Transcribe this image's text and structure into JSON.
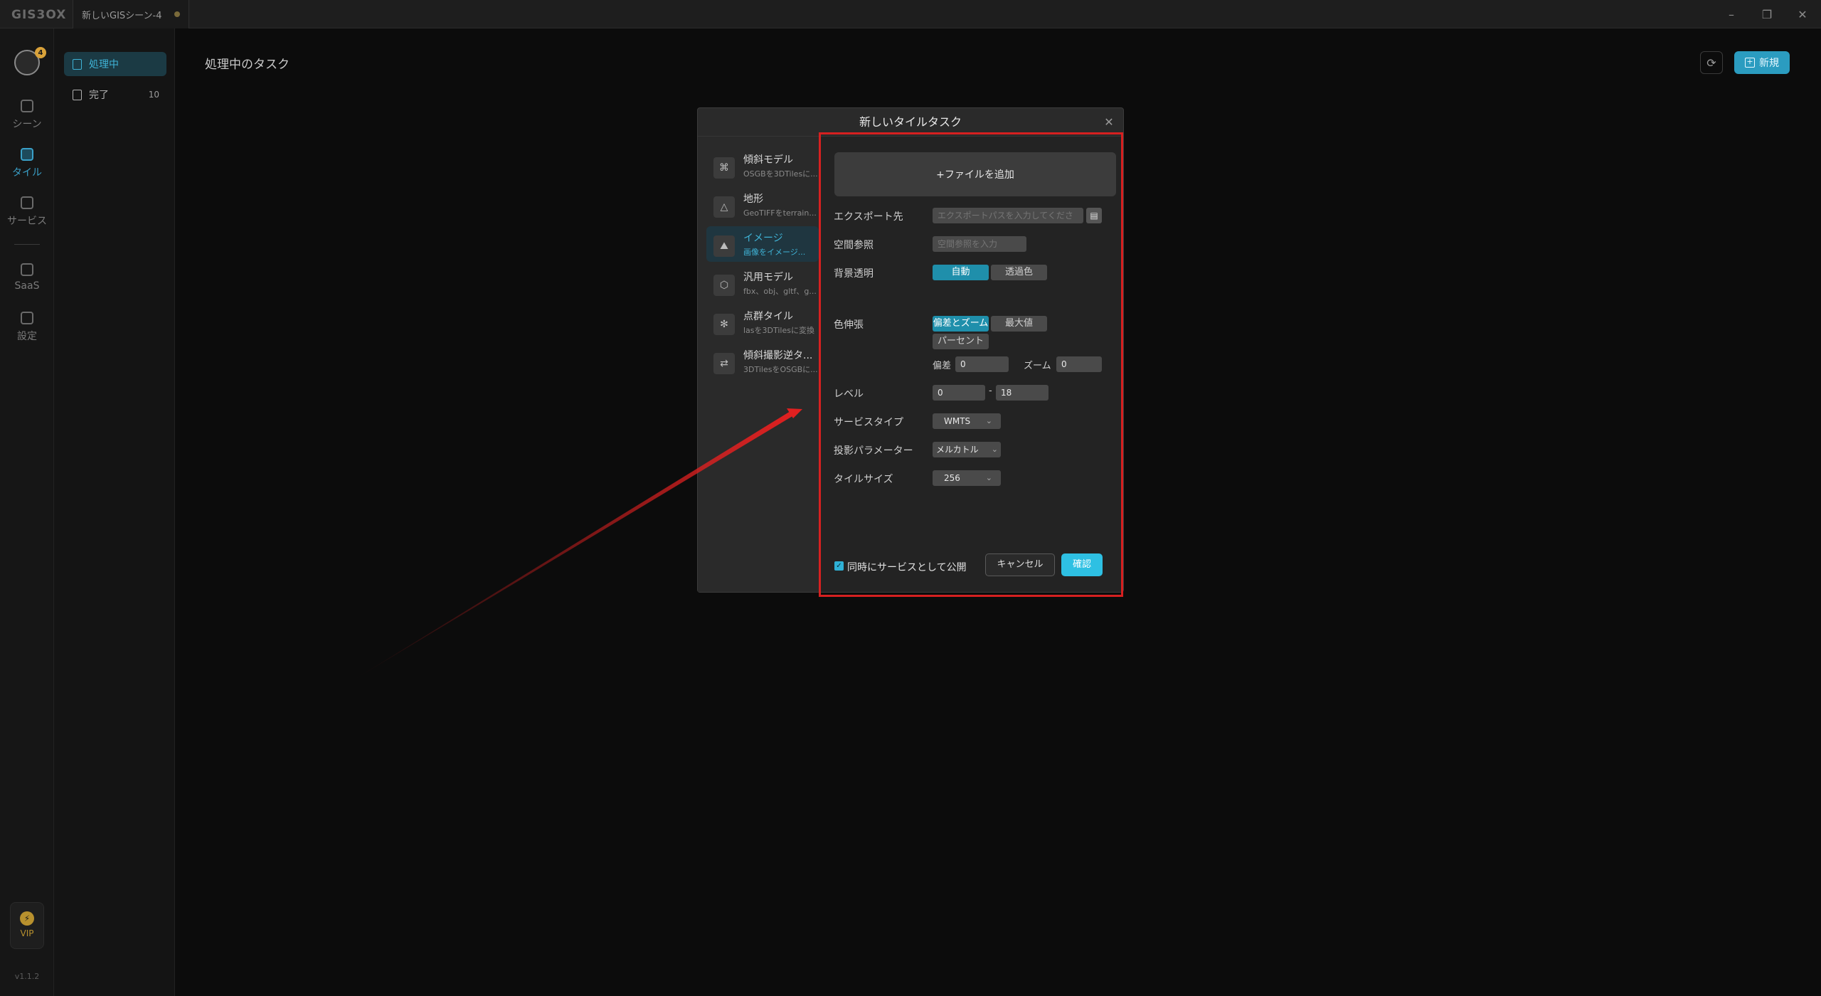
{
  "app": {
    "logo": "GIS3OX",
    "doc_tab": "新しいGISシーン-4"
  },
  "rail": {
    "avatar_badge": "4",
    "items": [
      {
        "label": "シーン",
        "icon": "scene-icon"
      },
      {
        "label": "タイル",
        "icon": "tile-icon"
      },
      {
        "label": "サービス",
        "icon": "service-icon"
      },
      {
        "label": "SaaS",
        "icon": "saas-icon"
      },
      {
        "label": "設定",
        "icon": "settings-icon"
      }
    ],
    "vip": "VIP",
    "version": "v1.1.2"
  },
  "sidenav": {
    "items": [
      {
        "label": "処理中",
        "count": ""
      },
      {
        "label": "完了",
        "count": "10"
      }
    ]
  },
  "main": {
    "title": "処理中のタスク",
    "new_label": "新規"
  },
  "dialog": {
    "title": "新しいタイルタスク",
    "types": [
      {
        "name": "傾斜モデル",
        "desc": "OSGBを3DTilesに..."
      },
      {
        "name": "地形",
        "desc": "GeoTIFFをterrain..."
      },
      {
        "name": "イメージ",
        "desc": "画像をイメージ..."
      },
      {
        "name": "汎用モデル",
        "desc": "fbx、obj、gltf、g..."
      },
      {
        "name": "点群タイル",
        "desc": "lasを3DTilesに変換"
      },
      {
        "name": "傾斜撮影逆タ...",
        "desc": "3DTilesをOSGBに..."
      }
    ],
    "add_file": "+ファイルを追加",
    "export": {
      "label": "エクスポート先",
      "placeholder": "エクスポートパスを入力してくださ"
    },
    "crs": {
      "label": "空間参照",
      "placeholder": "空間参照を入力"
    },
    "bg": {
      "label": "背景透明",
      "auto": "自動",
      "color": "透過色"
    },
    "stretch": {
      "label": "色伸張",
      "opt1": "偏差とズーム",
      "opt2": "最大値",
      "opt3": "パーセント",
      "offset_label": "偏差",
      "offset_value": "0",
      "zoom_label": "ズーム",
      "zoom_value": "0"
    },
    "level": {
      "label": "レベル",
      "min": "0",
      "sep": "-",
      "max": "18"
    },
    "service_type": {
      "label": "サービスタイプ",
      "value": "WMTS"
    },
    "projection": {
      "label": "投影パラメーター",
      "value": "メルカトル"
    },
    "tile_size": {
      "label": "タイルサイズ",
      "value": "256"
    },
    "publish": "同時にサービスとして公開",
    "cancel": "キャンセル",
    "confirm": "確認"
  },
  "colors": {
    "accent": "#2b9cc0",
    "annotation": "#d62020"
  }
}
